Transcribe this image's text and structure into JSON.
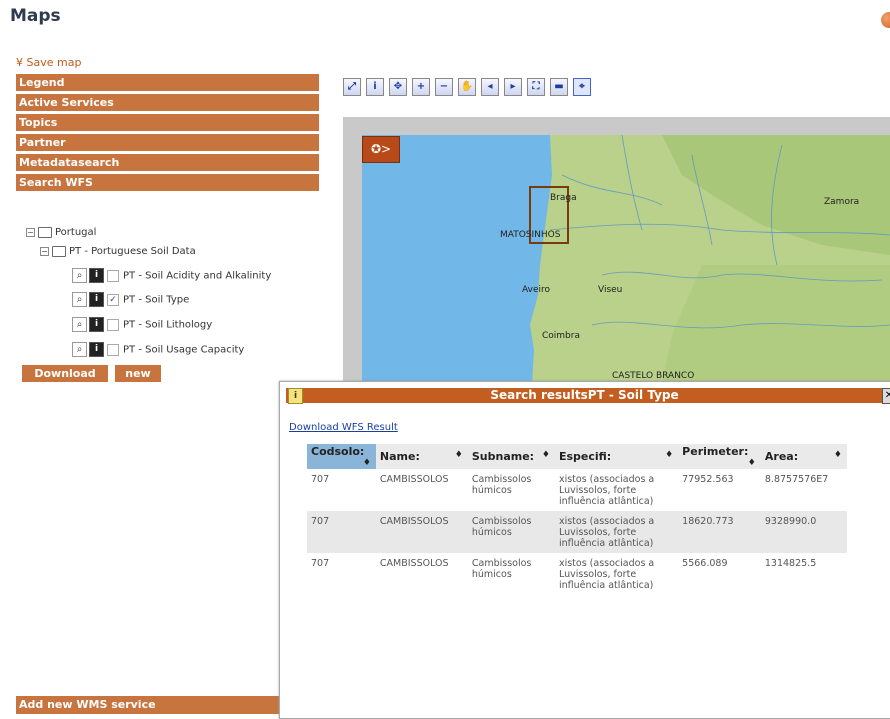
{
  "page": {
    "title": "Maps"
  },
  "sidebar": {
    "save_map": "¥ Save map",
    "accordion": [
      "Legend",
      "Active Services",
      "Topics",
      "Partner",
      "Metadatasearch",
      "Search WFS"
    ],
    "tree": {
      "root": "Portugal",
      "group": "PT - Portuguese Soil Data",
      "layers": [
        {
          "label": "PT - Soil Acidity and Alkalinity",
          "checked": false
        },
        {
          "label": "PT - Soil Type",
          "checked": true
        },
        {
          "label": "PT - Soil Lithology",
          "checked": false
        },
        {
          "label": "PT - Soil Usage Capacity",
          "checked": false
        }
      ]
    },
    "download_button": "Download",
    "new_button": "new",
    "add_wms": "Add new WMS service"
  },
  "toolbar": {
    "tools": [
      "zoom-to-extent",
      "info",
      "pan-extent",
      "zoom-in",
      "zoom-out",
      "pan-hand",
      "back",
      "forward",
      "full-extent",
      "print",
      "select-feature"
    ]
  },
  "map": {
    "cities": [
      "Braga",
      "Zamora",
      "MATOSINHOS",
      "Aveiro",
      "Viseu",
      "Coimbra",
      "CASTELO BRANCO"
    ]
  },
  "dialog": {
    "title": "Search resultsPT - Soil Type",
    "info_icon": "i",
    "download_link": "Download WFS Result",
    "columns": [
      "Codsolo:",
      "Name:",
      "Subname:",
      "Especifi:",
      "Perimeter:",
      "Area:"
    ],
    "rows": [
      {
        "codsolo": "707",
        "name": "CAMBISSOLOS",
        "subname": "Cambissolos húmicos",
        "especifi": "xistos (associados a Luvissolos, forte influência atlântica)",
        "perimeter": "77952.563",
        "area": "8.8757576E7"
      },
      {
        "codsolo": "707",
        "name": "CAMBISSOLOS",
        "subname": "Cambissolos húmicos",
        "especifi": "xistos (associados a Luvissolos, forte influência atlântica)",
        "perimeter": "18620.773",
        "area": "9328990.0"
      },
      {
        "codsolo": "707",
        "name": "CAMBISSOLOS",
        "subname": "Cambissolos húmicos",
        "especifi": "xistos (associados a Luvissolos, forte influência atlântica)",
        "perimeter": "5566.089",
        "area": "1314825.5"
      }
    ]
  },
  "colors": {
    "accent": "#c8743f",
    "dialog_header": "#c35d20",
    "sorted_header": "#8ab5d8",
    "sea": "#6fb6e6",
    "land": "#b7cf85"
  }
}
